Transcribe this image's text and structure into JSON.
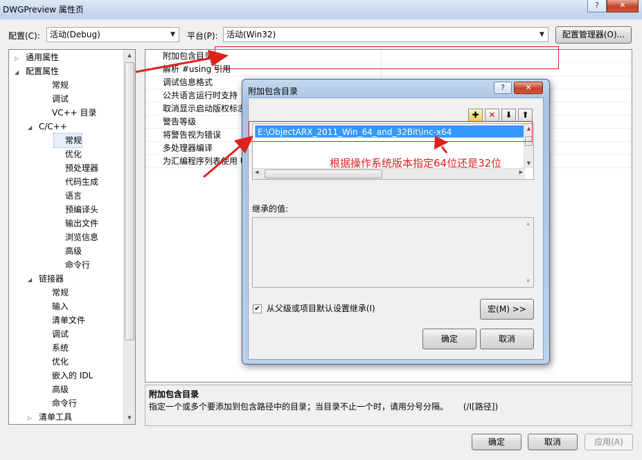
{
  "window": {
    "title": "DWGPreview 属性页",
    "help_label": "?",
    "close_label": "✕"
  },
  "config": {
    "label": "配置(C):",
    "value": "活动(Debug)",
    "platform_label": "平台(P):",
    "platform_value": "活动(Win32)",
    "manager_button": "配置管理器(O)..."
  },
  "tree": {
    "items": [
      {
        "label": "通用属性",
        "expander": "▷"
      },
      {
        "label": "配置属性",
        "expander": "◢"
      },
      {
        "label": "常规"
      },
      {
        "label": "调试"
      },
      {
        "label": "VC++ 目录"
      },
      {
        "label": "C/C++",
        "expander": "◢"
      },
      {
        "label": "常规"
      },
      {
        "label": "优化"
      },
      {
        "label": "预处理器"
      },
      {
        "label": "代码生成"
      },
      {
        "label": "语言"
      },
      {
        "label": "预编译头"
      },
      {
        "label": "输出文件"
      },
      {
        "label": "浏览信息"
      },
      {
        "label": "高级"
      },
      {
        "label": "命令行"
      },
      {
        "label": "链接器",
        "expander": "◢"
      },
      {
        "label": "常规"
      },
      {
        "label": "输入"
      },
      {
        "label": "清单文件"
      },
      {
        "label": "调试"
      },
      {
        "label": "系统"
      },
      {
        "label": "优化"
      },
      {
        "label": "嵌入的 IDL"
      },
      {
        "label": "高级"
      },
      {
        "label": "命令行"
      },
      {
        "label": "清单工具",
        "expander": "▷"
      }
    ]
  },
  "grid": {
    "rows": [
      "附加包含目录",
      "解析 #using 引用",
      "调试信息格式",
      "公共语言运行时支持",
      "取消显示启动版权标志",
      "警告等级",
      "将警告视为错误",
      "多处理器编译",
      "为汇编程序列表使用 Unicode"
    ]
  },
  "description": {
    "title": "附加包含目录",
    "text": "指定一个或多个要添加到包含路径中的目录；当目录不止一个时，请用分号分隔。",
    "switch": "(/I[路径])"
  },
  "dialog": {
    "title": "附加包含目录",
    "help_label": "?",
    "close_label": "✕",
    "entry": "E:\\ObjectARX_2011_Win_64_and_32Bit\\inc-x64",
    "inherited_label": "继承的值:",
    "inherit_checkbox_label": "从父级或项目默认设置继承(I)",
    "inherit_checked": true,
    "macro_button": "宏(M) >>",
    "ok_button": "确定",
    "cancel_button": "取消"
  },
  "annotation": {
    "text": "根据操作系统版本指定64位还是32位",
    "color": "#e0201d"
  },
  "footer": {
    "ok": "确定",
    "cancel": "取消",
    "apply": "应用(A)"
  }
}
